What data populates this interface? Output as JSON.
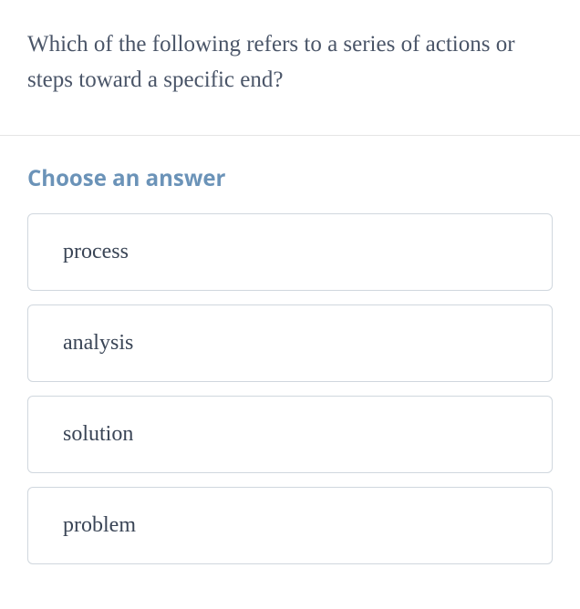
{
  "question": {
    "text": "Which of the following refers to a series of actions or steps toward a specific end?"
  },
  "instruction": "Choose an answer",
  "options": [
    {
      "label": "process"
    },
    {
      "label": "analysis"
    },
    {
      "label": "solution"
    },
    {
      "label": "problem"
    }
  ]
}
